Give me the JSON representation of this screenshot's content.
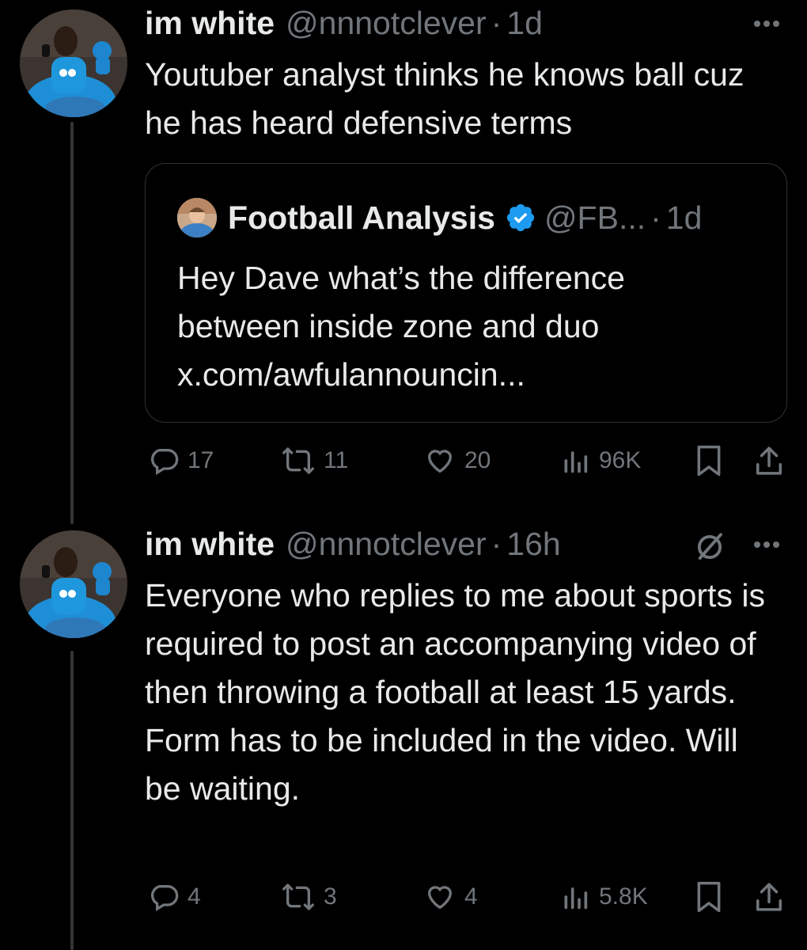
{
  "tweets": [
    {
      "name": "im white",
      "handle": "@nnnotclever",
      "separator": "·",
      "time": "1d",
      "text": "Youtuber analyst thinks he knows ball cuz he has heard defensive terms",
      "quote": {
        "name": "Football Analysis",
        "handle": "@FB...",
        "separator": "·",
        "time": "1d",
        "text": "Hey Dave what’s the difference between inside zone and duo x.com/awfulannouncin..."
      },
      "stats": {
        "replies": "17",
        "reposts": "11",
        "likes": "20",
        "views": "96K"
      }
    },
    {
      "name": "im white",
      "handle": "@nnnotclever",
      "separator": "·",
      "time": "16h",
      "text": "Everyone who replies to me about sports is required to post an accompanying video of then throwing a football at least 15 yards. Form has to be included in the video. Will be waiting.",
      "stats": {
        "replies": "4",
        "reposts": "3",
        "likes": "4",
        "views": "5.8K"
      }
    }
  ],
  "icons": {
    "reply": "reply-icon",
    "repost": "repost-icon",
    "like": "heart-icon",
    "views": "views-icon",
    "bookmark": "bookmark-icon",
    "share": "share-icon",
    "more": "more-icon",
    "grok": "grok-icon",
    "verified": "verified-badge-icon"
  },
  "colors": {
    "background": "#000000",
    "text": "#e7e9ea",
    "muted": "#71767b",
    "border": "#2f3336",
    "verified": "#1d9bf0"
  }
}
